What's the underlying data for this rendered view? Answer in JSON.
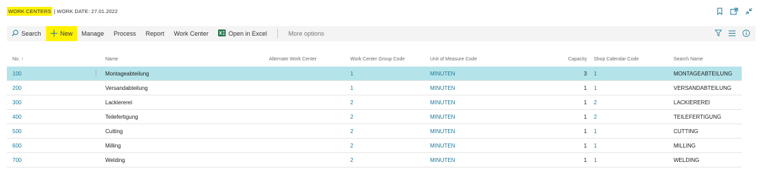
{
  "title": {
    "page_name": "WORK CENTERS",
    "separator": "|",
    "work_date": "WORK DATE: 27.01.2022"
  },
  "actions": {
    "search": "Search",
    "new": "New",
    "manage": "Manage",
    "process": "Process",
    "report": "Report",
    "work_center": "Work Center",
    "open_in_excel": "Open in Excel",
    "more_options": "More options"
  },
  "columns": {
    "no": "No. ↑",
    "name": "Name",
    "alternate": "Alternate Work Center",
    "group": "Work Center Group Code",
    "uom": "Unit of Measure Code",
    "capacity": "Capacity",
    "calendar": "Shop Calendar Code",
    "search_name": "Search Name"
  },
  "rows": [
    {
      "no": "100",
      "name": "Montageabteilung",
      "alt": "",
      "group": "1",
      "uom": "MINUTEN",
      "capacity": "3",
      "calendar": "1",
      "search_name": "MONTAGEABTEILUNG"
    },
    {
      "no": "200",
      "name": "Versandabteilung",
      "alt": "",
      "group": "1",
      "uom": "MINUTEN",
      "capacity": "1",
      "calendar": "1",
      "search_name": "VERSANDABTEILUNG"
    },
    {
      "no": "300",
      "name": "Lackiererei",
      "alt": "",
      "group": "2",
      "uom": "MINUTEN",
      "capacity": "1",
      "calendar": "2",
      "search_name": "LACKIEREREI"
    },
    {
      "no": "400",
      "name": "Teilefertigung",
      "alt": "",
      "group": "2",
      "uom": "MINUTEN",
      "capacity": "1",
      "calendar": "2",
      "search_name": "TEILEFERTIGUNG"
    },
    {
      "no": "500",
      "name": "Cutting",
      "alt": "",
      "group": "2",
      "uom": "MINUTEN",
      "capacity": "1",
      "calendar": "1",
      "search_name": "CUTTING"
    },
    {
      "no": "600",
      "name": "Milling",
      "alt": "",
      "group": "2",
      "uom": "MINUTEN",
      "capacity": "1",
      "calendar": "1",
      "search_name": "MILLING"
    },
    {
      "no": "700",
      "name": "Welding",
      "alt": "",
      "group": "2",
      "uom": "MINUTEN",
      "capacity": "1",
      "calendar": "1",
      "search_name": "WELDING"
    }
  ],
  "row_menu_glyph": "⋮",
  "colors": {
    "accent_link": "#1f7a9c",
    "highlight": "#fff200",
    "selected_row": "#b4e4ea",
    "excel_green": "#1e7145"
  },
  "icons": [
    "search-icon",
    "plus-icon",
    "excel-icon",
    "filter-icon",
    "list-view-icon",
    "info-icon",
    "bookmark-icon",
    "open-new-window-icon",
    "collapse-icon"
  ]
}
